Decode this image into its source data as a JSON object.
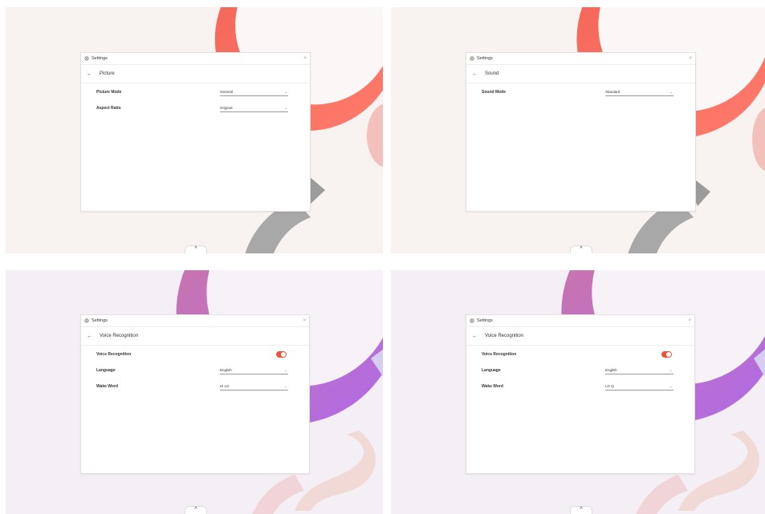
{
  "colors": {
    "picture_bg": "#f8f2f1",
    "voice_bg": "#f4eef5",
    "toggle_on": "#e9553f"
  },
  "icons": {
    "gear": "gear-icon",
    "close": "close-icon",
    "back": "back-arrow-icon",
    "dropdown": "chevron-down-icon",
    "collapse": "chevron-up-icon"
  },
  "screens": [
    {
      "window_title": "Settings",
      "close_glyph": "×",
      "back_glyph": "←",
      "page_title": "Picture",
      "collapse_glyph": "^",
      "rows": [
        {
          "label": "Picture Mode",
          "value": "General",
          "chevron": "⌄"
        },
        {
          "label": "Aspect Ratio",
          "value": "Original",
          "chevron": "⌄"
        }
      ]
    },
    {
      "window_title": "Settings",
      "close_glyph": "×",
      "back_glyph": "←",
      "page_title": "Sound",
      "collapse_glyph": "^",
      "rows": [
        {
          "label": "Sound Mode",
          "value": "Standard",
          "chevron": "⌄"
        }
      ]
    },
    {
      "window_title": "Settings",
      "close_glyph": "×",
      "back_glyph": "←",
      "page_title": "Voice Recognition",
      "collapse_glyph": "^",
      "toggle_label": "Voice Recognition",
      "toggle_on": true,
      "rows": [
        {
          "label": "Language",
          "value": "English",
          "chevron": "⌄"
        },
        {
          "label": "Wake Word",
          "value": "Hi LG",
          "chevron": "⌄"
        }
      ]
    },
    {
      "window_title": "Settings",
      "close_glyph": "×",
      "back_glyph": "←",
      "page_title": "Voice Recognition",
      "collapse_glyph": "^",
      "toggle_label": "Voice Recognition",
      "toggle_on": true,
      "rows": [
        {
          "label": "Language",
          "value": "English",
          "chevron": "⌄"
        },
        {
          "label": "Wake Word",
          "value": "LG Q",
          "chevron": "⌄"
        }
      ]
    }
  ]
}
